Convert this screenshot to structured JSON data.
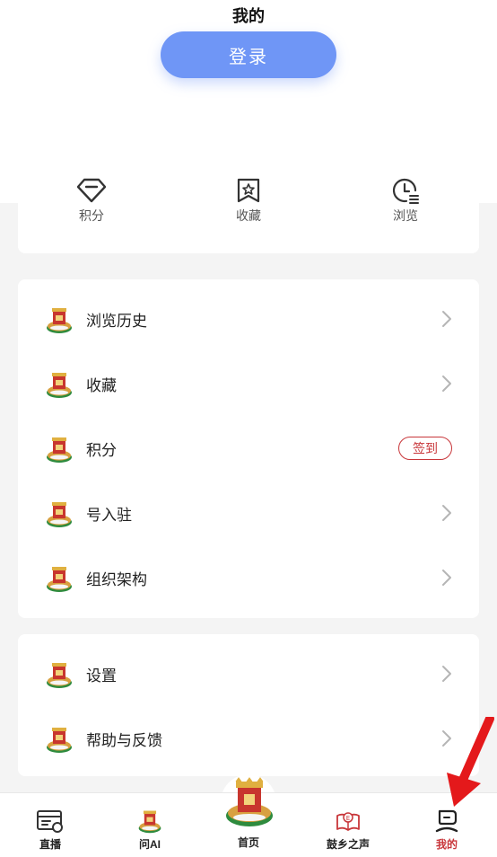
{
  "header": {
    "title": "我的",
    "login_label": "登录"
  },
  "stats": [
    {
      "label": "积分",
      "icon": "diamond-icon"
    },
    {
      "label": "收藏",
      "icon": "bookmark-star-icon"
    },
    {
      "label": "浏览",
      "icon": "clock-history-icon"
    }
  ],
  "menu_group_1": [
    {
      "label": "浏览历史",
      "icon": "app-logo-icon"
    },
    {
      "label": "收藏",
      "icon": "app-logo-icon"
    },
    {
      "label": "积分",
      "icon": "app-logo-icon",
      "action_label": "签到"
    },
    {
      "label": "号入驻",
      "icon": "app-logo-icon"
    },
    {
      "label": "组织架构",
      "icon": "app-logo-icon"
    }
  ],
  "menu_group_2": [
    {
      "label": "设置",
      "icon": "app-logo-icon"
    },
    {
      "label": "帮助与反馈",
      "icon": "app-logo-icon"
    }
  ],
  "tabbar": [
    {
      "label": "直播",
      "icon": "live-browser-icon"
    },
    {
      "label": "问AI",
      "icon": "app-logo-icon"
    },
    {
      "label": "首页",
      "icon": "app-logo-icon"
    },
    {
      "label": "鼓乡之声",
      "icon": "book-e-icon"
    },
    {
      "label": "我的",
      "icon": "user-icon",
      "active": true
    }
  ],
  "colors": {
    "accent_blue": "#6f96f6",
    "accent_red": "#c8363a",
    "background": "#f4f4f4"
  }
}
